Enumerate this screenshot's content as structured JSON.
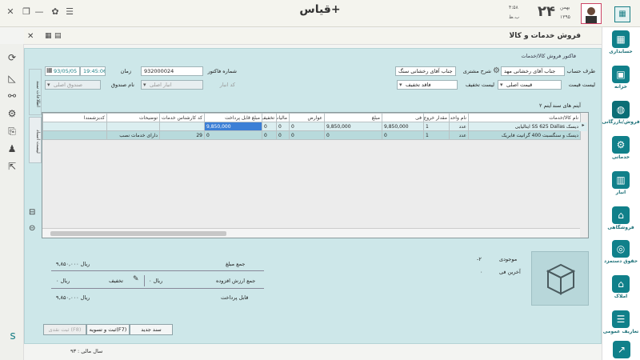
{
  "app": {
    "title": "قیاس+"
  },
  "header": {
    "date_day": "۲۴",
    "date_month": "بهمن",
    "date_year": "۱۳۹۵",
    "time": "۴:۵۸",
    "weekday": "ب.ظ"
  },
  "form": {
    "title": "فروش خدمات و کالا",
    "group_title": "فاکتور فروش کالا/خدمات",
    "labels": {
      "customer": "طرف حساب",
      "customer_desc": "شرح مشتری",
      "invoice_no": "شماره فاکتور",
      "time": "زمان",
      "price_list": "لیست قیمت",
      "discount_list": "لیست تخفیف",
      "warehouse_code": "کد انبار",
      "fund_name": "نام صندوق"
    },
    "values": {
      "customer": "جناب آقای رخشانی مهد",
      "customer_desc": "جناب آقای رخشانی   سنگ",
      "invoice_no": "932000024",
      "time": "19:45:06",
      "date": "93/05/05",
      "price_list": "قیمت اصلی",
      "discount_list": "فاقد تخفیف",
      "warehouse": "انبار اصلی",
      "fund": "صندوق اصلی"
    }
  },
  "tabs": {
    "doc_info": "اطلاعات سند",
    "payment_list": "لیست اسناد"
  },
  "grid": {
    "caption": "آیتم های سند",
    "count_label": "۲ آیتم",
    "columns": [
      "نام کالا/خدمات",
      "نام واحد",
      "مقدار خروج",
      "فی",
      "مبلغ",
      "عوارض",
      "مالیات",
      "تخفیف",
      "مبلغ قابل پرداخت",
      "کد کارشناس خدمات",
      "توضیحات",
      "کدبزشمندا"
    ],
    "rows": [
      {
        "name": "دیسک SS 625 Dallas ایتالیایی",
        "unit": "عدد",
        "qty": "1",
        "fee": "9,850,000",
        "amount": "9,850,000",
        "toll": "0",
        "tax": "0",
        "discount": "0",
        "payable": "9,850,000",
        "expert": "",
        "desc": "",
        "extra": ""
      },
      {
        "name": "دیسک و سنگسبت 400 گرانیت فابریک",
        "unit": "عدد",
        "qty": "1",
        "fee": "0",
        "amount": "0",
        "toll": "0",
        "tax": "0",
        "discount": "0",
        "payable": "0",
        "expert": "29",
        "desc": "دارای خدمات نصب",
        "extra": ""
      }
    ]
  },
  "totals": {
    "sum_label": "جمع مبلغ",
    "sum_value": "۹,۸۵۰,۰۰۰ ریال",
    "vat_label": "جمع ارزش افزوده",
    "vat_value": "۰ ریال",
    "discount_label": "تخفیف",
    "discount_value": "۰ ریال",
    "payable_label": "قابل پرداخت",
    "payable_value": "۹,۸۵۰,۰۰۰ ریال",
    "stock_label": "موجودی",
    "stock_value": "-۲",
    "last_fee_label": "آخرین فی",
    "last_fee_value": "۰"
  },
  "buttons": {
    "new_doc": "سند جدید",
    "save_settle": "ثبت و تسویه(F7)",
    "cash_save": "ثبت نقدی (F8)"
  },
  "sidebar": {
    "items": [
      {
        "label": "حسابداری",
        "icon": "calculator-icon"
      },
      {
        "label": "خزانه",
        "icon": "safe-icon"
      },
      {
        "label": "فروش/بازرگانی",
        "icon": "globe-icon"
      },
      {
        "label": "خدماتی",
        "icon": "gear-icon"
      },
      {
        "label": "انبار",
        "icon": "warehouse-icon"
      },
      {
        "label": "فروشگاهی",
        "icon": "store-icon"
      },
      {
        "label": "حقوق دستمزد",
        "icon": "coins-icon"
      },
      {
        "label": "املاک",
        "icon": "house-icon"
      },
      {
        "label": "تعاریف عمومی",
        "icon": "list-icon"
      }
    ]
  },
  "footer": {
    "fiscal_year": "سال مالی : ۹۳"
  },
  "colors": {
    "accent": "#10808a",
    "panel": "#cde7e9",
    "selection": "#3b7fd6"
  }
}
